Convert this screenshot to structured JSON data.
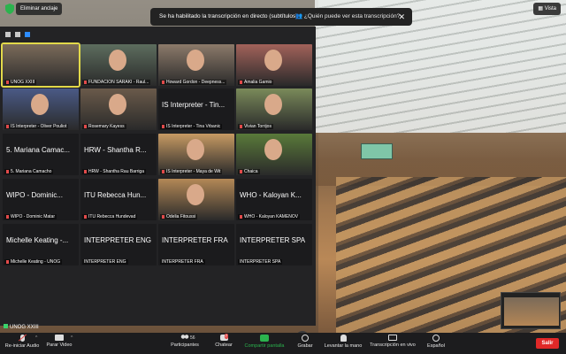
{
  "topbar": {
    "unpin_label": "Eliminar anclaje",
    "view_label": "Vista",
    "notice_text": "Se ha habilitado la transcripción en directo (subtítulos)",
    "notice_link": "¿Quién puede ver esta transcripción?"
  },
  "gallery": {
    "tiles": [
      {
        "big": "",
        "label": "UNOG XXIII",
        "video": true
      },
      {
        "big": "",
        "label": "FUNDACION SARAKI - Raul...",
        "video": true
      },
      {
        "big": "",
        "label": "Howard Gordon - Deepness...",
        "video": true
      },
      {
        "big": "",
        "label": "Amalia Gamio",
        "video": true
      },
      {
        "big": "",
        "label": "IS Interpreter - Oliver Pouliot",
        "video": true
      },
      {
        "big": "",
        "label": "Rosemary Kayess",
        "video": true
      },
      {
        "big": "IS Interpreter - Tin...",
        "label": "IS Interpreter - Tina Vrbanic",
        "video": false
      },
      {
        "big": "",
        "label": "Vivian Torrijos",
        "video": true
      },
      {
        "big": "5. Mariana Camac...",
        "label": "5. Mariana Camacho",
        "video": false
      },
      {
        "big": "HRW - Shantha R...",
        "label": "HRW - Shantha Rau Barriga",
        "video": false
      },
      {
        "big": "",
        "label": "IS Interpreter - Maya de Wit",
        "video": true
      },
      {
        "big": "",
        "label": "Chaica",
        "video": true
      },
      {
        "big": "WIPO - Dominic...",
        "label": "WIPO - Dominic Matar",
        "video": false
      },
      {
        "big": "ITU Rebecca Hun...",
        "label": "ITU Rebecca Hundevad",
        "video": false
      },
      {
        "big": "",
        "label": "Odelia Fitoussi",
        "video": true
      },
      {
        "big": "WHO - Kaloyan K...",
        "label": "WHO - Kaloyan KAMENOV",
        "video": false
      },
      {
        "big": "Michelle Keating -...",
        "label": "Michelle Keating - UNOG",
        "video": false
      },
      {
        "big": "INTERPRETER ENG",
        "label": "INTERPRETER ENG",
        "video": false
      },
      {
        "big": "INTERPRETER FRA",
        "label": "INTERPRETER FRA",
        "video": false
      },
      {
        "big": "INTERPRETER SPA",
        "label": "INTERPRETER SPA",
        "video": false
      }
    ]
  },
  "own_name": "UNOG XXIII",
  "toolbar": {
    "audio": "Re-iniciar Audio",
    "video": "Parar Video",
    "participants": "Participantes",
    "participants_count": "56",
    "chat": "Chatear",
    "chat_badge": "7",
    "share": "Compartir pantalla",
    "record": "Grabar",
    "hand": "Levantar la mano",
    "transcript": "Transcripción en vivo",
    "language": "Español",
    "leave": "Salir"
  },
  "colors": {
    "share_green": "#2bb34e",
    "leave_red": "#e02828",
    "active_speaker": "#e2d94a"
  }
}
